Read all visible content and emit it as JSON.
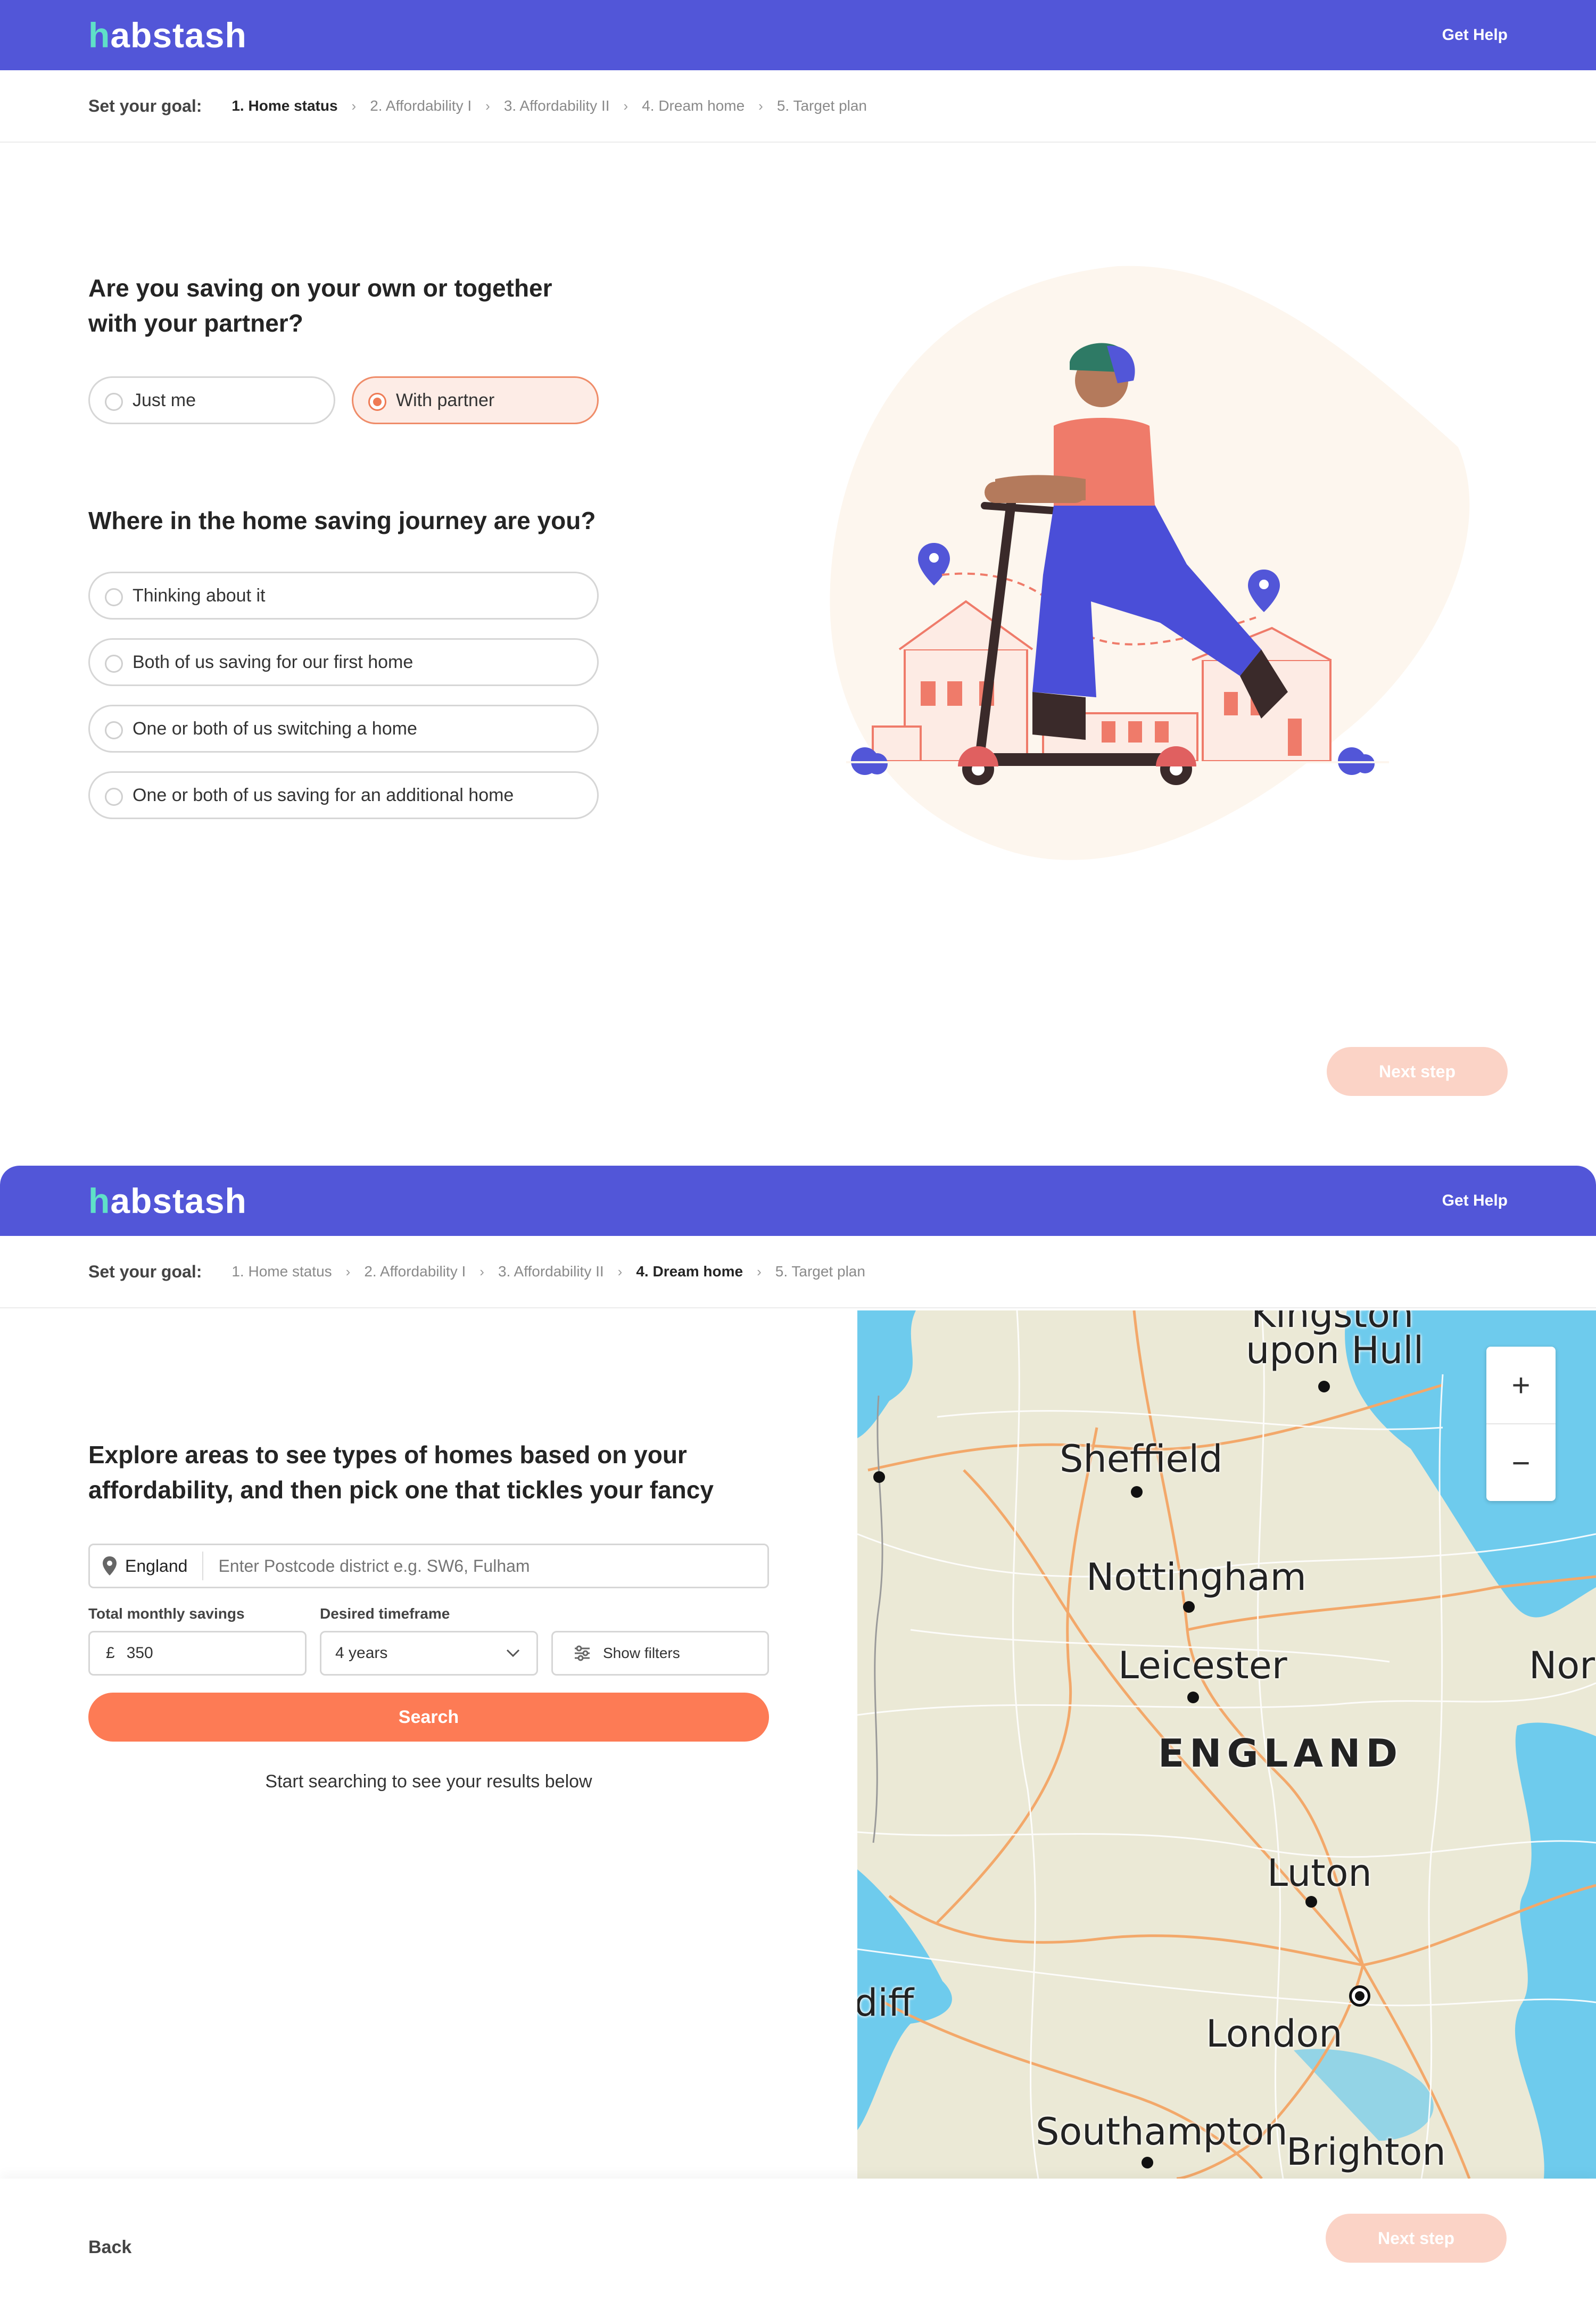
{
  "brand": {
    "logo_h": "h",
    "logo_rest": "abstash",
    "logo_color": "#5fe0c7",
    "header_color": "#5256d8"
  },
  "header": {
    "help": "Get Help"
  },
  "goal_label": "Set your goal:",
  "steps": [
    "1. Home status",
    "2. Affordability I",
    "3. Affordability II",
    "4. Dream home",
    "5. Target plan"
  ],
  "screen1": {
    "active_step": 0,
    "question1": "Are you saving on your own or together with your partner?",
    "options1": [
      {
        "label": "Just me",
        "selected": false
      },
      {
        "label": "With partner",
        "selected": true
      }
    ],
    "question2": "Where in the home saving journey are you?",
    "options2": [
      {
        "label": "Thinking about it",
        "selected": false
      },
      {
        "label": "Both of us saving for our first home",
        "selected": false
      },
      {
        "label": "One or both of us switching a home",
        "selected": false
      },
      {
        "label": "One or both of us saving for an additional home",
        "selected": false
      }
    ],
    "next": "Next step"
  },
  "screen2": {
    "active_step": 3,
    "title": "Explore areas to see types of homes based on your affordability, and then pick one that tickles your fancy",
    "location": {
      "region": "England",
      "placeholder": "Enter Postcode district e.g. SW6, Fulham",
      "icon": "location-pin-icon"
    },
    "savings": {
      "label": "Total monthly savings",
      "currency": "£",
      "value": "350"
    },
    "timeframe": {
      "label": "Desired timeframe",
      "value": "4 years"
    },
    "filters": "Show filters",
    "search": "Search",
    "hint": "Start searching to see your results below",
    "map": {
      "labels": [
        "Kingston",
        "upon Hull",
        "Sheffield",
        "Nottingham",
        "Leicester",
        "ENGLAND",
        "Luton",
        "London",
        "Southampton",
        "Brighton",
        "diff",
        "Nor"
      ],
      "zoom_in": "+",
      "zoom_out": "−"
    },
    "back": "Back",
    "next": "Next step"
  }
}
